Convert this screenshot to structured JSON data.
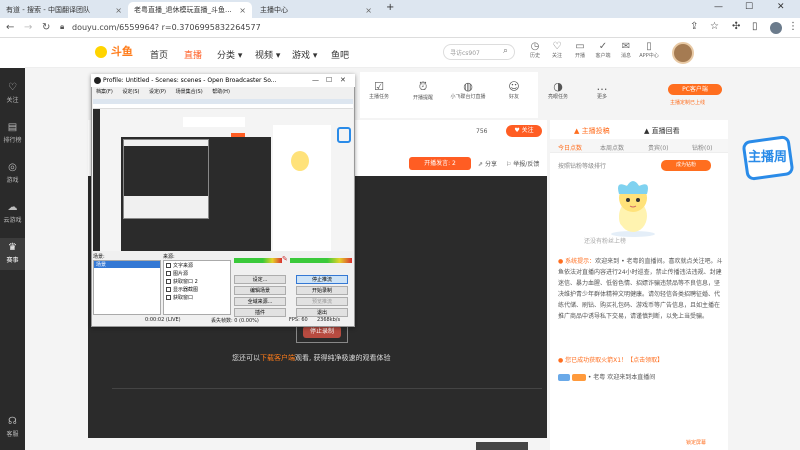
{
  "browser": {
    "tabs": [
      {
        "label": "有道 - 搜索 - 中国翻译团队",
        "active": false
      },
      {
        "label": "老粤直播_退休模玩直播_斗鱼...",
        "active": true
      },
      {
        "label": "主播中心",
        "active": false
      }
    ],
    "url": "douyu.com/6559964? r=0.3706995832264577",
    "new_tab": "+",
    "win_controls": [
      "—",
      "☐",
      "✕"
    ]
  },
  "left_nav": {
    "items": [
      {
        "icon": "heart-icon",
        "glyph": "♡",
        "label": "关注"
      },
      {
        "icon": "ranking-icon",
        "glyph": "▤",
        "label": "排行榜"
      },
      {
        "icon": "game-icon",
        "glyph": "◎",
        "label": "游戏"
      },
      {
        "icon": "cloud-game-icon",
        "glyph": "☁",
        "label": "云游戏"
      },
      {
        "icon": "trophy-icon",
        "glyph": "♛",
        "label": "赛事",
        "active": true
      },
      {
        "icon": "headset-icon",
        "glyph": "☊",
        "label": "客服"
      }
    ]
  },
  "header": {
    "logo_text": "斗鱼",
    "nav": [
      {
        "label": "首页"
      },
      {
        "label": "直播",
        "active": true
      },
      {
        "label": "分类 ▾"
      },
      {
        "label": "视频 ▾"
      },
      {
        "label": "游戏 ▾"
      },
      {
        "label": "鱼吧"
      }
    ],
    "search_placeholder": "寻访cs907",
    "icons": [
      {
        "icon": "history-icon",
        "glyph": "◷",
        "label": "历史"
      },
      {
        "icon": "follow-icon",
        "glyph": "♡",
        "label": "关注"
      },
      {
        "icon": "live-icon",
        "glyph": "▭",
        "label": "开播"
      },
      {
        "icon": "task-icon",
        "glyph": "✓",
        "label": "客户端"
      },
      {
        "icon": "message-icon",
        "glyph": "✉",
        "label": "消息"
      },
      {
        "icon": "app-icon",
        "glyph": "▯",
        "label": "APP中心"
      }
    ]
  },
  "func_bar": [
    {
      "icon": "anchor-task-icon",
      "glyph": "☑",
      "label": "主播任务"
    },
    {
      "icon": "alarm-icon",
      "glyph": "⏰",
      "label": "开播提醒"
    },
    {
      "icon": "controller-icon",
      "glyph": "◍",
      "label": "小飞碟台灯直播"
    },
    {
      "icon": "friend-icon",
      "glyph": "☺",
      "label": "好友"
    },
    {
      "icon": "rank-task-icon",
      "glyph": "◑",
      "label": "亮眼任务"
    },
    {
      "icon": "more-icon",
      "glyph": "…",
      "label": "更多"
    }
  ],
  "pc_client": {
    "label": "PC客户端",
    "hint": "主播定制已上线"
  },
  "room": {
    "views": "756",
    "follow": "♥ 关注",
    "hot": "开播发言: 2",
    "share": "分享",
    "report": "举报/反馈"
  },
  "stage": {
    "text_before": "您还可以",
    "text_link": "下载客户端",
    "text_after": "观看, 获得纯净极速的观看体验",
    "record_btn": "停止录制"
  },
  "right_panel": {
    "tabs": [
      "主播投稿",
      "直播回看"
    ],
    "sub_tabs": [
      "今日点数",
      "本周点数",
      "贵宾(0)",
      "钻粉(0)"
    ],
    "rank_label": "按照钻粉等级排行",
    "become": "成为钻粉",
    "empty_text": "还没有粉丝上榜",
    "notice_head": "系统提示：",
    "notice_body": "欢迎来到 • 老粤的直播间。喜欢就点关注吧。斗鱼依法对直播内容进行24小时巡查，禁止传播违法违规、封建迷信、暴力血腥、低俗色情、招嫖诈骗违禁品等不良信息，坚决维护青少年群体精神文明健康。请勿轻信各类招聘征婚、代练代储、刷钻、购买礼包码、游戏币等广告信息，且如主播在推广商品中诱导私下交易，请谨慎判断，以免上当受骗。",
    "gift": "您已成功获取火箭X1！【点击领取】",
    "welcome": "• 老粤 欢迎来到本直播间",
    "scroll_lock": "锁定屏幕"
  },
  "banner_text": "主播周",
  "obs": {
    "title": "Profile: Untitled - Scenes: scenes - Open Broadcaster So...",
    "menu": [
      "档案(F)",
      "设定(S)",
      "设定(P)",
      "场景集合(S)",
      "帮助(H)"
    ],
    "scenes_label": "场景:",
    "scene_item": "场景",
    "sources_label": "来源:",
    "sources": [
      "文字来源",
      "图片源",
      "获取窗口 2",
      "显示器截图",
      "获取窗口"
    ],
    "buttons": [
      "设定...",
      "编辑场景",
      "全域来源...",
      "插件",
      "停止推流",
      "开始录制",
      "预览推流",
      "退出"
    ],
    "status": [
      "0:00:02 (LIVE)",
      "丢失帧数: 0 (0.00%)",
      "FPS: 60",
      "2368kb/s"
    ]
  }
}
